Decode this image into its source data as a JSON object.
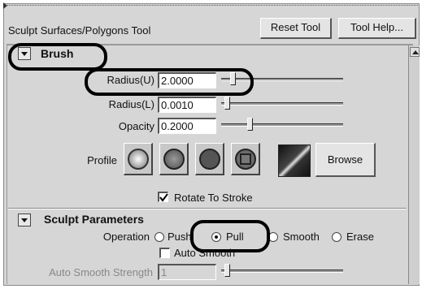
{
  "window": {
    "title": "Sculpt Surfaces/Polygons Tool",
    "reset_label": "Reset Tool",
    "help_label": "Tool Help..."
  },
  "brush": {
    "section_label": "Brush",
    "radius_u": {
      "label": "Radius(U)",
      "value": "2.0000",
      "slider_fraction": 0.05
    },
    "radius_l": {
      "label": "Radius(L)",
      "value": "0.0010",
      "slider_fraction": 0.0
    },
    "opacity": {
      "label": "Opacity",
      "value": "0.2000",
      "slider_fraction": 0.2
    },
    "profile_label": "Profile",
    "browse_label": "Browse",
    "rotate_to_stroke": {
      "label": "Rotate To Stroke",
      "checked": true
    }
  },
  "sculpt": {
    "section_label": "Sculpt Parameters",
    "operation_label": "Operation",
    "operations": [
      {
        "label": "Push",
        "selected": false
      },
      {
        "label": "Pull",
        "selected": true
      },
      {
        "label": "Smooth",
        "selected": false
      },
      {
        "label": "Erase",
        "selected": false
      }
    ],
    "auto_smooth": {
      "label": "Auto Smooth",
      "checked": false
    },
    "auto_smooth_strength": {
      "label": "Auto Smooth Strength",
      "value": "1",
      "slider_fraction": 0.0
    }
  },
  "colors": {
    "panel": "#d6d6d6",
    "highlight": "#000000"
  }
}
